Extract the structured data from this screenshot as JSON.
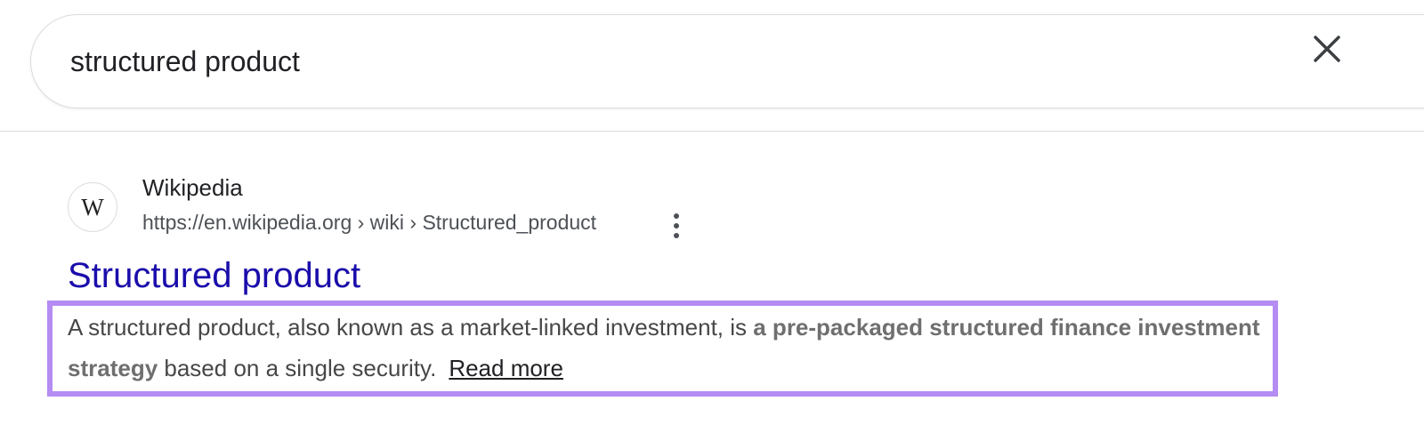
{
  "search": {
    "query": "structured product",
    "clear_icon": "close-icon"
  },
  "result": {
    "favicon_letter": "W",
    "site_name": "Wikipedia",
    "breadcrumb": "https://en.wikipedia.org › wiki › Structured_product",
    "more_icon": "more-vert-icon",
    "title": "Structured product",
    "snippet_part1": "A structured product, also known as a market-linked investment, is ",
    "snippet_bold": "a pre-packaged structured finance investment strategy",
    "snippet_part2": " based on a single security.",
    "read_more": "Read more"
  },
  "colors": {
    "title_link": "#1a0dab",
    "highlight_border": "#b48cf2"
  }
}
